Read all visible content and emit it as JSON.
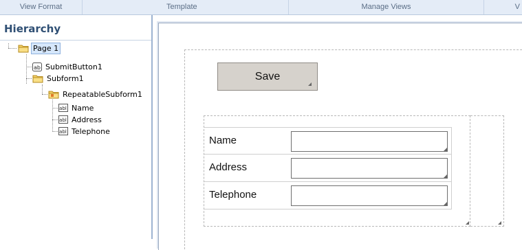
{
  "ribbon": {
    "groups": [
      {
        "label": "View Format"
      },
      {
        "label": "Template"
      },
      {
        "label": "Manage Views"
      },
      {
        "label": "V"
      }
    ]
  },
  "hierarchy": {
    "title": "Hierarchy",
    "nodes": [
      {
        "label": "Page 1",
        "icon": "folder-icon"
      },
      {
        "label": "SubmitButton1",
        "icon": "button-field-icon"
      },
      {
        "label": "Subform1",
        "icon": "folder-icon"
      },
      {
        "label": "RepeatableSubform1",
        "icon": "repeatable-folder-icon"
      },
      {
        "label": "Name",
        "icon": "text-field-icon"
      },
      {
        "label": "Address",
        "icon": "text-field-icon"
      },
      {
        "label": "Telephone",
        "icon": "text-field-icon"
      }
    ]
  },
  "canvas": {
    "save_label": "Save",
    "fields": [
      {
        "label": "Name",
        "value": ""
      },
      {
        "label": "Address",
        "value": ""
      },
      {
        "label": "Telephone",
        "value": ""
      }
    ]
  },
  "colors": {
    "ribbon_bg": "#e4ecf7",
    "panel_title": "#2f4f74",
    "selection_bg": "#d6e7fb",
    "folder": "#f2c94c",
    "button_bg": "#d6d2cc"
  }
}
